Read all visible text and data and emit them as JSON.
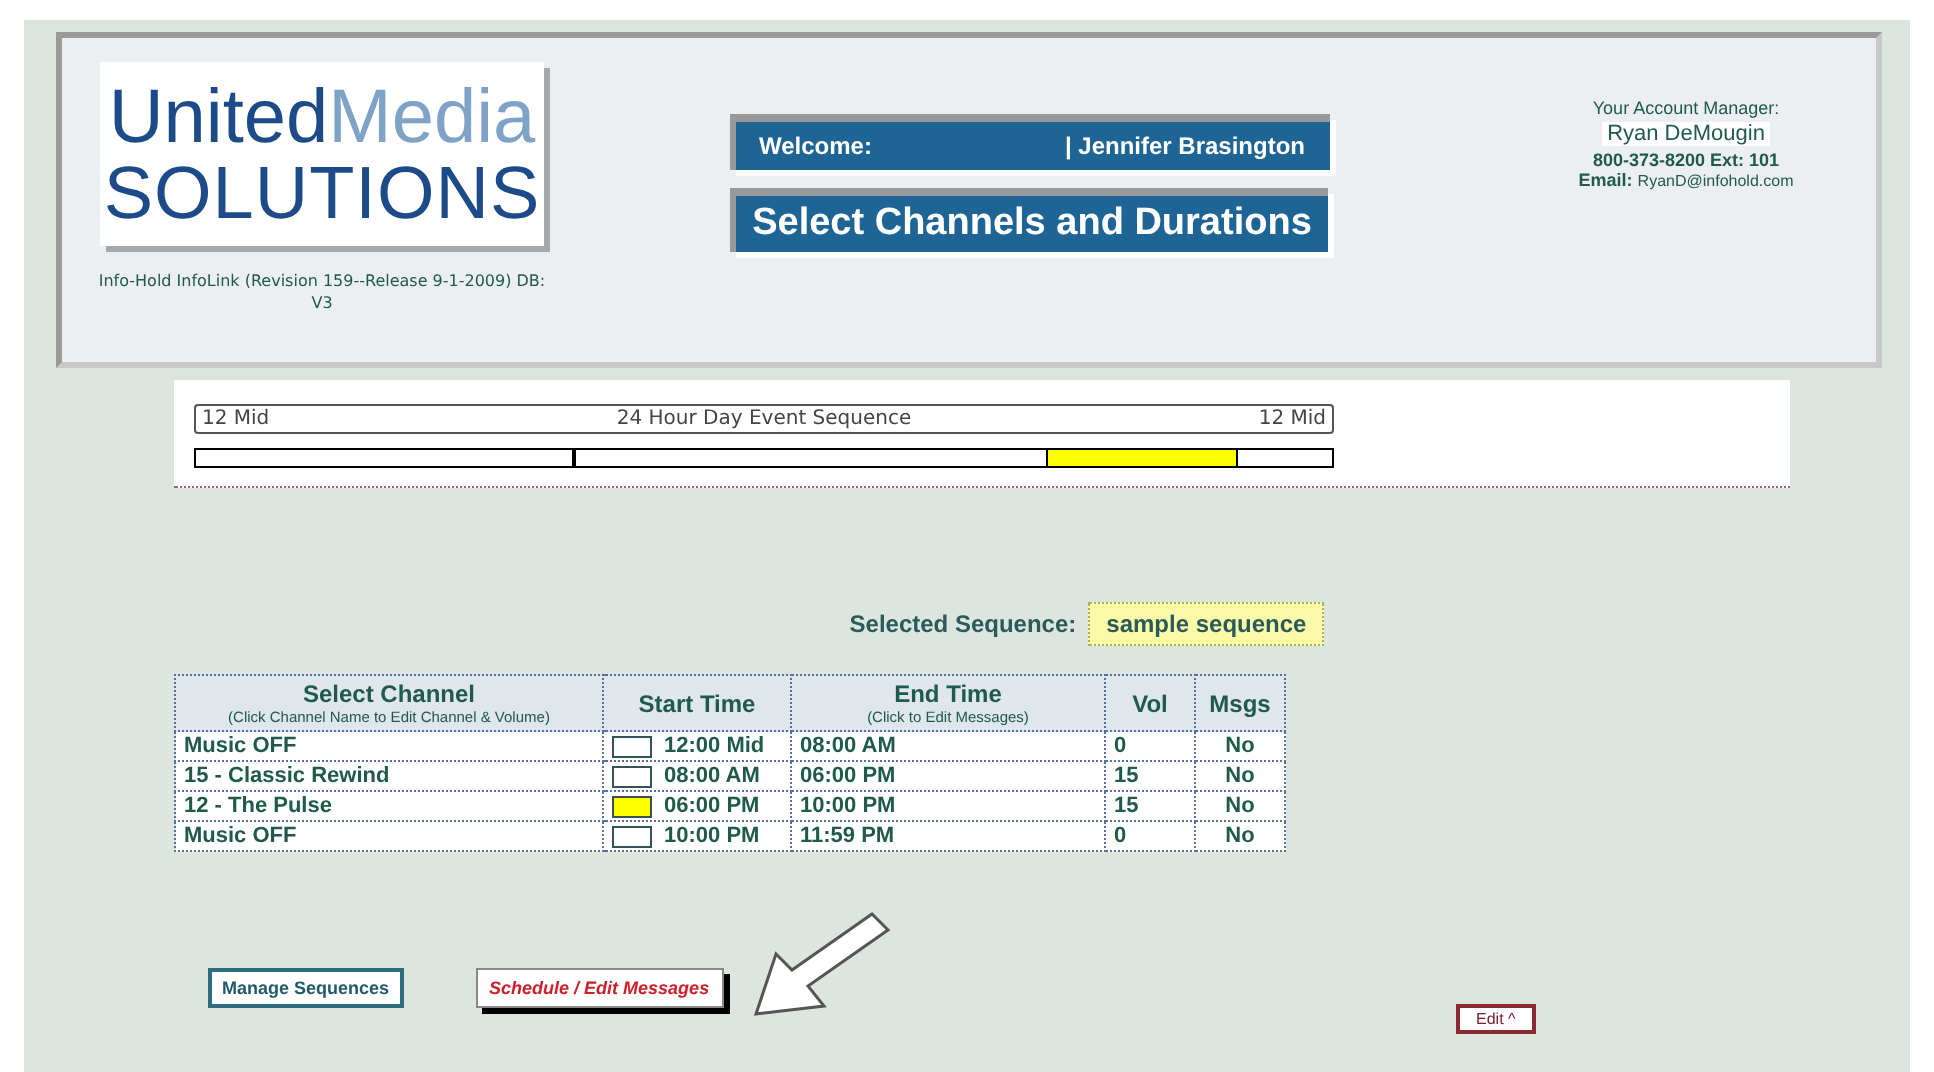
{
  "header": {
    "logo_top_a": "United",
    "logo_top_b": "Media",
    "logo_bottom": "SOLUTIONS",
    "version": "Info-Hold InfoLink (Revision 159--Release 9-1-2009) DB: V3",
    "welcome_label": "Welcome:",
    "welcome_name": "| Jennifer Brasington",
    "page_title": "Select Channels and Durations",
    "manager_label": "Your Account Manager:",
    "manager_name": "Ryan DeMougin",
    "manager_phone": "800-373-8200 Ext: ",
    "manager_ext": "101",
    "email_label": "Email:",
    "email": "RyanD@infohold.com"
  },
  "timeline": {
    "start_label": "12 Mid",
    "title": "24 Hour Day Event Sequence",
    "end_label": "12 Mid",
    "segments": [
      {
        "color": "#ffffff"
      },
      {
        "color": "#ffffff"
      },
      {
        "color": "#ffff00"
      },
      {
        "color": "#ffffff"
      }
    ]
  },
  "selected_sequence": {
    "label": "Selected Sequence:",
    "value": "sample sequence"
  },
  "table": {
    "columns": [
      {
        "title": "Select Channel",
        "note": "(Click Channel Name to Edit Channel & Volume)"
      },
      {
        "title": "Start Time"
      },
      {
        "title": "End Time",
        "note": "(Click to Edit Messages)"
      },
      {
        "title": "Vol"
      },
      {
        "title": "Msgs"
      }
    ],
    "rows": [
      {
        "channel": "Music OFF",
        "color": "#ffffff",
        "start": "12:00 Mid",
        "end": "08:00 AM",
        "vol": "0",
        "msgs": "No"
      },
      {
        "channel": "15 - Classic Rewind",
        "color": "#ffffff",
        "start": "08:00 AM",
        "end": "06:00 PM",
        "vol": "15",
        "msgs": "No"
      },
      {
        "channel": "12 - The Pulse",
        "color": "#ffff00",
        "start": "06:00 PM",
        "end": "10:00 PM",
        "vol": "15",
        "msgs": "No"
      },
      {
        "channel": "Music OFF",
        "color": "#ffffff",
        "start": "10:00 PM",
        "end": "11:59 PM",
        "vol": "0",
        "msgs": "No"
      }
    ]
  },
  "buttons": {
    "manage": "Manage Sequences",
    "schedule": "Schedule / Edit Messages",
    "edit": "Edit ^"
  }
}
